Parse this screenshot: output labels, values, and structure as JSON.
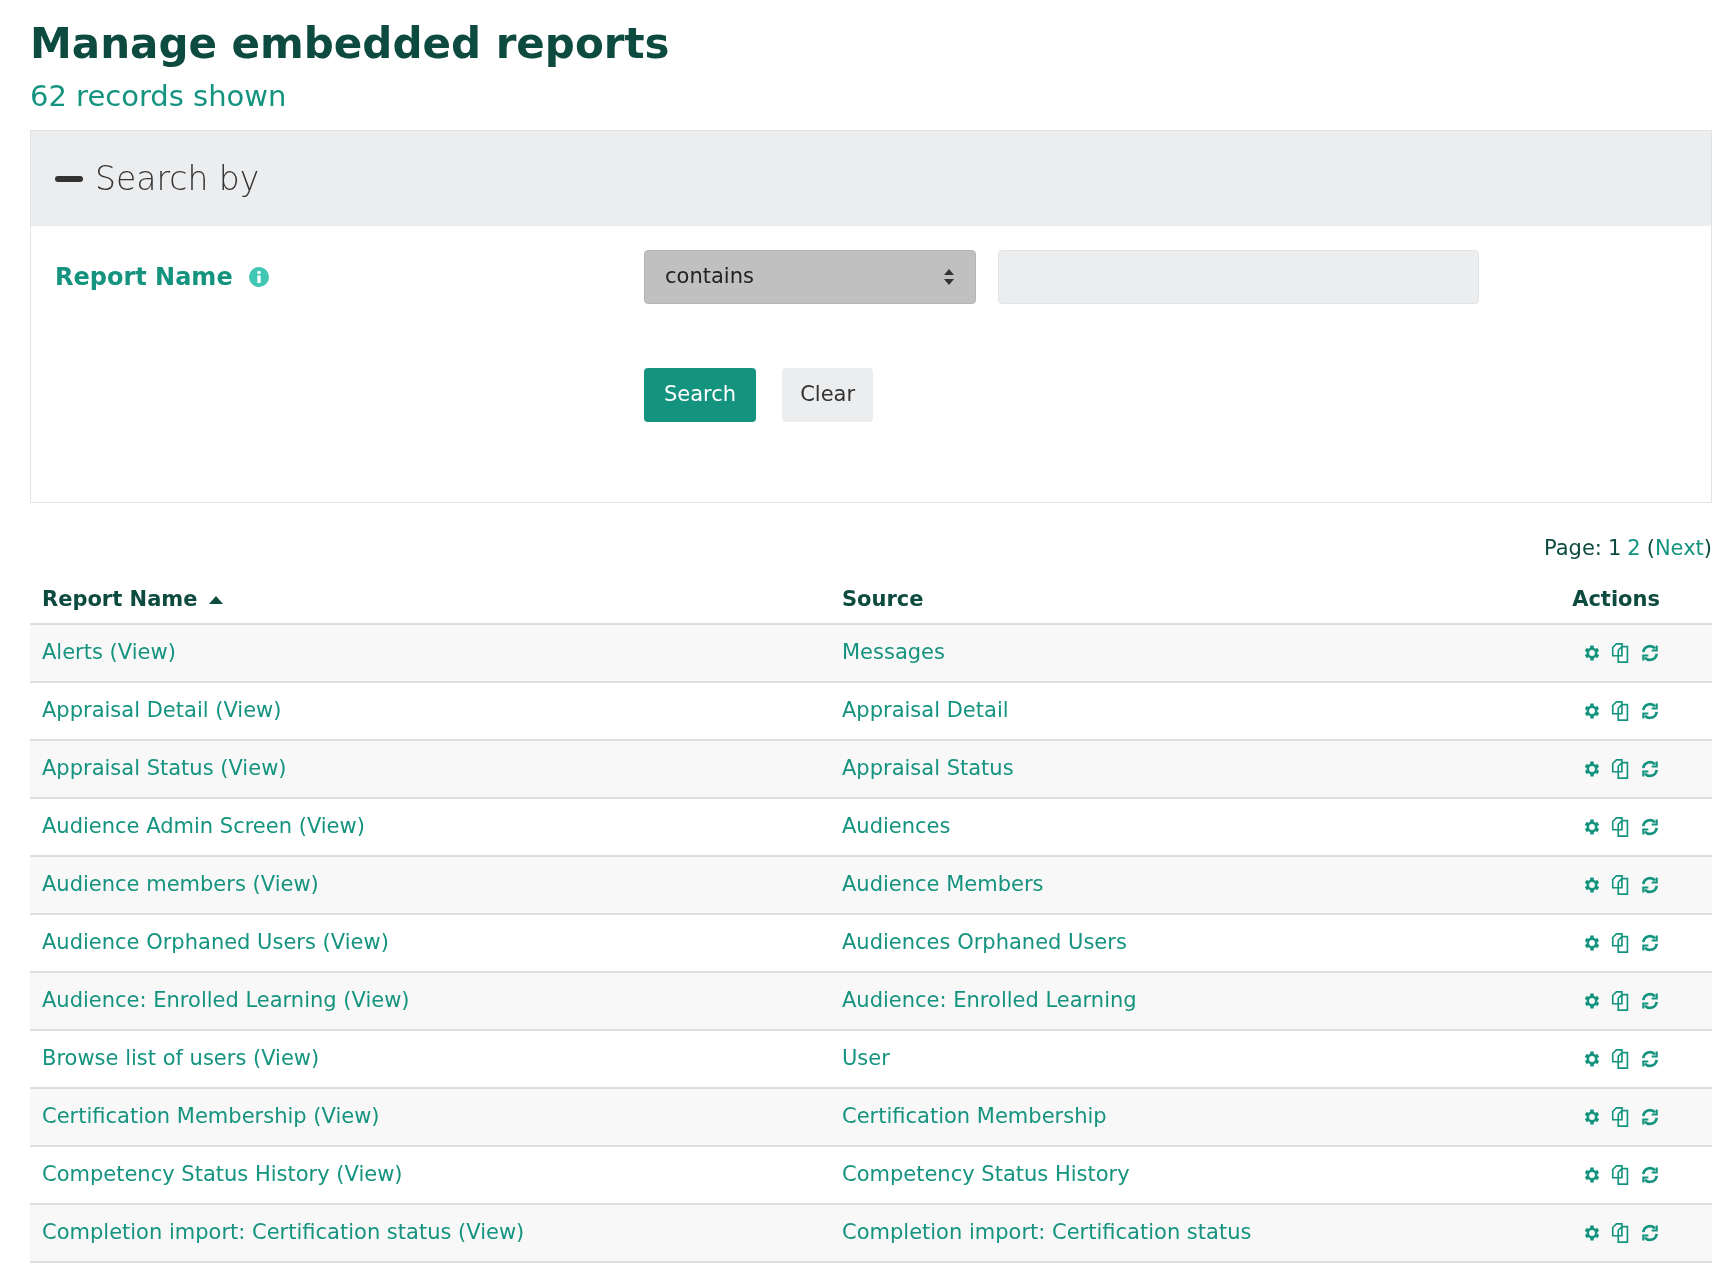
{
  "title": "Manage embedded reports",
  "record_count": "62 records shown",
  "search_panel": {
    "title": "Search by",
    "expanded": true,
    "field_label": "Report Name",
    "operator": "contains",
    "buttons": [
      {
        "label": "Search",
        "kind": "primary"
      },
      {
        "label": "Clear",
        "kind": "secondary"
      }
    ]
  },
  "pagination": {
    "label": "Page:",
    "pages": [
      {
        "label": "1",
        "selected": true
      },
      {
        "label": "2",
        "selected": false
      }
    ],
    "open": "(",
    "next": "Next",
    "close": ")"
  },
  "table": {
    "columns": [
      {
        "label": "Report Name",
        "sorted": true
      },
      {
        "label": "Source",
        "sorted": false
      },
      {
        "label": "Actions",
        "sorted": false
      }
    ],
    "rows": [
      {
        "name": "Alerts (View)",
        "source": "Messages"
      },
      {
        "name": "Appraisal Detail (View)",
        "source": "Appraisal Detail"
      },
      {
        "name": "Appraisal Status (View)",
        "source": "Appraisal Status"
      },
      {
        "name": "Audience Admin Screen (View)",
        "source": "Audiences"
      },
      {
        "name": "Audience members (View)",
        "source": "Audience Members"
      },
      {
        "name": "Audience Orphaned Users (View)",
        "source": "Audiences Orphaned Users"
      },
      {
        "name": "Audience: Enrolled Learning (View)",
        "source": "Audience: Enrolled Learning"
      },
      {
        "name": "Browse list of users (View)",
        "source": "User"
      },
      {
        "name": "Certification Membership (View)",
        "source": "Certification Membership"
      },
      {
        "name": "Competency Status History (View)",
        "source": "Competency Status History"
      },
      {
        "name": "Completion import: Certification status (View)",
        "source": "Completion import: Certification status"
      }
    ]
  }
}
